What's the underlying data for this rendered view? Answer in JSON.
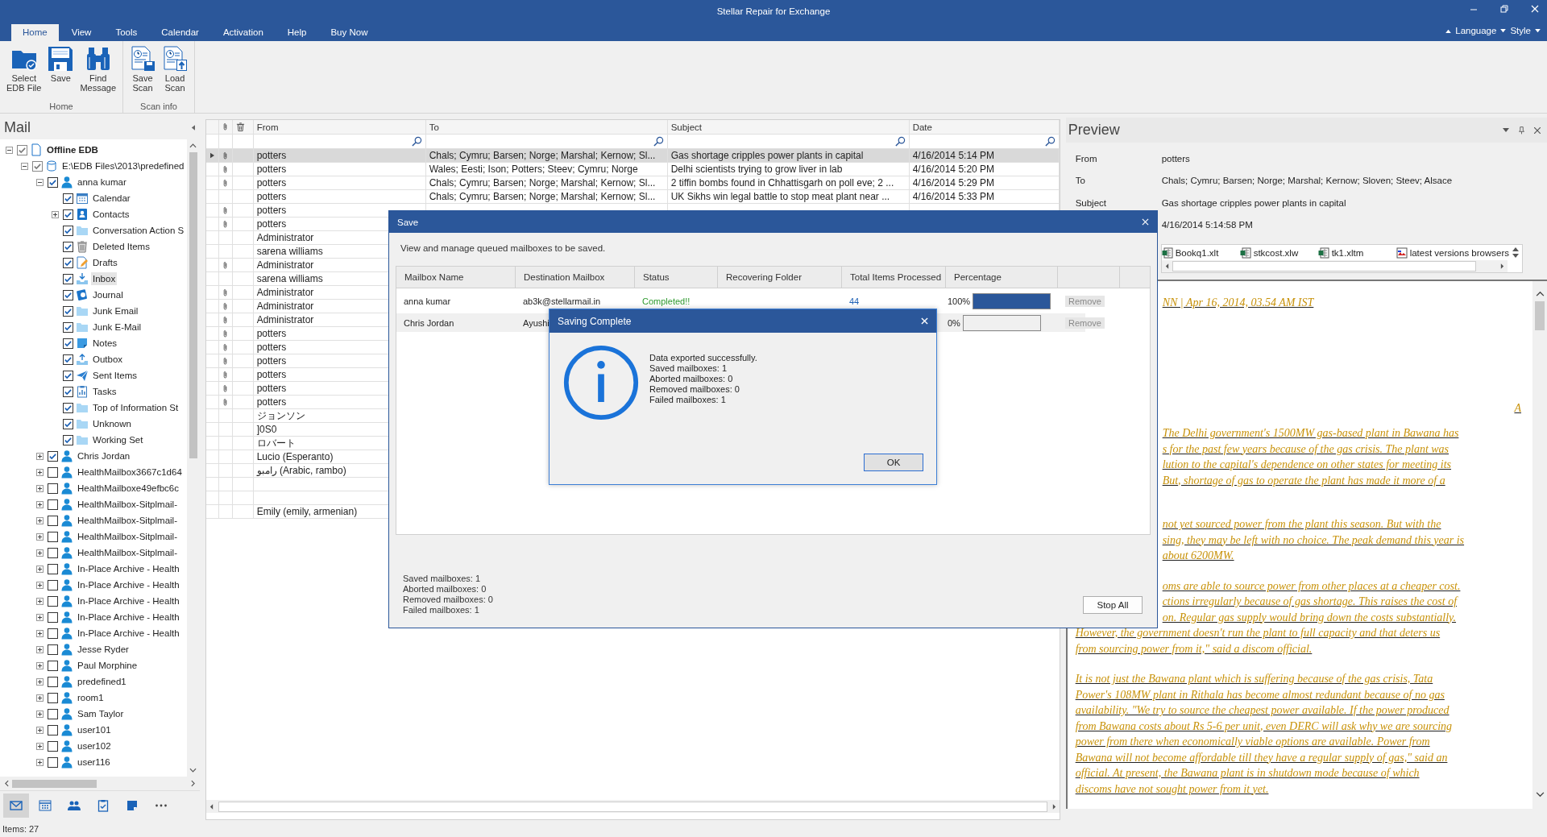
{
  "window": {
    "title": "Stellar Repair for Exchange"
  },
  "ribbon": {
    "tabs": [
      {
        "label": "Home",
        "selected": true
      },
      {
        "label": "View",
        "selected": false
      },
      {
        "label": "Tools",
        "selected": false
      },
      {
        "label": "Calendar",
        "selected": false
      },
      {
        "label": "Activation",
        "selected": false
      },
      {
        "label": "Help",
        "selected": false
      },
      {
        "label": "Buy Now",
        "selected": false
      }
    ],
    "right_menus": [
      "Language",
      "Style"
    ],
    "groups": [
      {
        "label": "Home",
        "buttons": [
          {
            "kind": "select_file",
            "label": "Select\nEDB File"
          },
          {
            "kind": "save",
            "label": "Save"
          },
          {
            "kind": "find",
            "label": "Find\nMessage"
          }
        ]
      },
      {
        "label": "Scan info",
        "buttons": [
          {
            "kind": "save_scan",
            "label": "Save\nScan"
          },
          {
            "kind": "load_scan",
            "label": "Load\nScan"
          }
        ]
      }
    ]
  },
  "mail_pane": {
    "title": "Mail",
    "tree": [
      {
        "label": "Offline EDB",
        "kind": "file",
        "checked": true,
        "partial": true,
        "expanded": true,
        "selected": false,
        "children": [
          {
            "label": "E:\\EDB Files\\2013\\predefined",
            "kind": "database",
            "checked": true,
            "partial": true,
            "expanded": true,
            "selected": false,
            "children": [
              {
                "label": "anna kumar",
                "kind": "mailbox",
                "checked": true,
                "expanded": true,
                "selected": false,
                "children": [
                  {
                    "label": "Calendar",
                    "kind": "calendar",
                    "checked": true,
                    "selected": false
                  },
                  {
                    "label": "Contacts",
                    "kind": "contacts",
                    "checked": true,
                    "expanded": false,
                    "selected": false
                  },
                  {
                    "label": "Conversation Action S",
                    "kind": "folder",
                    "checked": true,
                    "selected": false
                  },
                  {
                    "label": "Deleted Items",
                    "kind": "deleted",
                    "checked": true,
                    "selected": false
                  },
                  {
                    "label": "Drafts",
                    "kind": "drafts",
                    "checked": true,
                    "selected": false
                  },
                  {
                    "label": "Inbox",
                    "kind": "inbox",
                    "checked": true,
                    "selected": true
                  },
                  {
                    "label": "Journal",
                    "kind": "journal",
                    "checked": true,
                    "selected": false
                  },
                  {
                    "label": "Junk Email",
                    "kind": "folder",
                    "checked": true,
                    "selected": false
                  },
                  {
                    "label": "Junk E-Mail",
                    "kind": "folder",
                    "checked": true,
                    "selected": false
                  },
                  {
                    "label": "Notes",
                    "kind": "notes",
                    "checked": true,
                    "selected": false
                  },
                  {
                    "label": "Outbox",
                    "kind": "outbox",
                    "checked": true,
                    "selected": false
                  },
                  {
                    "label": "Sent Items",
                    "kind": "sent",
                    "checked": true,
                    "selected": false
                  },
                  {
                    "label": "Tasks",
                    "kind": "tasks",
                    "checked": true,
                    "selected": false
                  },
                  {
                    "label": "Top of Information St",
                    "kind": "folder",
                    "checked": true,
                    "selected": false
                  },
                  {
                    "label": "Unknown",
                    "kind": "folder",
                    "checked": true,
                    "selected": false
                  },
                  {
                    "label": "Working Set",
                    "kind": "folder",
                    "checked": true,
                    "selected": false
                  }
                ]
              },
              {
                "label": "Chris Jordan",
                "kind": "mailbox",
                "checked": true,
                "expanded": false,
                "selected": false
              },
              {
                "label": "HealthMailbox3667c1d64",
                "kind": "mailbox",
                "checked": false,
                "expanded": false,
                "selected": false
              },
              {
                "label": "HealthMailboxe49efbc6c",
                "kind": "mailbox",
                "checked": false,
                "expanded": false,
                "selected": false
              },
              {
                "label": "HealthMailbox-Sitplmail-",
                "kind": "mailbox",
                "checked": false,
                "expanded": false,
                "selected": false
              },
              {
                "label": "HealthMailbox-Sitplmail-",
                "kind": "mailbox",
                "checked": false,
                "expanded": false,
                "selected": false
              },
              {
                "label": "HealthMailbox-Sitplmail-",
                "kind": "mailbox",
                "checked": false,
                "expanded": false,
                "selected": false
              },
              {
                "label": "HealthMailbox-Sitplmail-",
                "kind": "mailbox",
                "checked": false,
                "expanded": false,
                "selected": false
              },
              {
                "label": "In-Place Archive - Health",
                "kind": "mailbox",
                "checked": false,
                "expanded": false,
                "selected": false
              },
              {
                "label": "In-Place Archive - Health",
                "kind": "mailbox",
                "checked": false,
                "expanded": false,
                "selected": false
              },
              {
                "label": "In-Place Archive - Health",
                "kind": "mailbox",
                "checked": false,
                "expanded": false,
                "selected": false
              },
              {
                "label": "In-Place Archive - Health",
                "kind": "mailbox",
                "checked": false,
                "expanded": false,
                "selected": false
              },
              {
                "label": "In-Place Archive - Health",
                "kind": "mailbox",
                "checked": false,
                "expanded": false,
                "selected": false
              },
              {
                "label": "Jesse Ryder",
                "kind": "mailbox",
                "checked": false,
                "expanded": false,
                "selected": false
              },
              {
                "label": "Paul Morphine",
                "kind": "mailbox",
                "checked": false,
                "expanded": false,
                "selected": false
              },
              {
                "label": "predefined1",
                "kind": "mailbox",
                "checked": false,
                "expanded": false,
                "selected": false
              },
              {
                "label": "room1",
                "kind": "mailbox",
                "checked": false,
                "expanded": false,
                "selected": false
              },
              {
                "label": "Sam Taylor",
                "kind": "mailbox",
                "checked": false,
                "expanded": false,
                "selected": false
              },
              {
                "label": "user101",
                "kind": "mailbox",
                "checked": false,
                "expanded": false,
                "selected": false
              },
              {
                "label": "user102",
                "kind": "mailbox",
                "checked": false,
                "expanded": false,
                "selected": false
              },
              {
                "label": "user116",
                "kind": "mailbox",
                "checked": false,
                "expanded": false,
                "selected": false
              }
            ]
          }
        ]
      }
    ],
    "nav": [
      {
        "kind": "mail",
        "selected": true
      },
      {
        "kind": "calendar",
        "selected": false
      },
      {
        "kind": "contacts",
        "selected": false
      },
      {
        "kind": "tasks",
        "selected": false
      },
      {
        "kind": "notes",
        "selected": false
      },
      {
        "kind": "more",
        "selected": false
      }
    ]
  },
  "message_list": {
    "columns": [
      "From",
      "To",
      "Subject",
      "Date"
    ],
    "rows": [
      {
        "selected": true,
        "attachment": true,
        "from": "potters",
        "to": "Chals; Cymru; Barsen; Norge; Marshal; Kernow; Sl...",
        "subject": "Gas shortage cripples power plants in capital",
        "date": "4/16/2014 5:14 PM"
      },
      {
        "selected": false,
        "attachment": true,
        "from": "potters",
        "to": "Wales; Eesti; Ison; Potters; Steev; Cymru; Norge",
        "subject": "Delhi scientists trying to grow liver in lab",
        "date": "4/16/2014 5:20 PM"
      },
      {
        "selected": false,
        "attachment": true,
        "from": "potters",
        "to": "Chals; Cymru; Barsen; Norge; Marshal; Kernow; Sl...",
        "subject": "2 tiffin bombs found in Chhattisgarh on poll eve; 2 ...",
        "date": "4/16/2014 5:29 PM"
      },
      {
        "selected": false,
        "attachment": false,
        "from": "potters",
        "to": "Chals; Cymru; Barsen; Norge; Marshal; Kernow; Sl...",
        "subject": "UK Sikhs win legal battle to stop meat plant near ...",
        "date": "4/16/2014 5:33 PM"
      },
      {
        "selected": false,
        "attachment": true,
        "from": "potters"
      },
      {
        "selected": false,
        "attachment": true,
        "from": "potters"
      },
      {
        "selected": false,
        "attachment": false,
        "from": "Administrator"
      },
      {
        "selected": false,
        "attachment": false,
        "from": "sarena williams"
      },
      {
        "selected": false,
        "attachment": true,
        "from": "Administrator"
      },
      {
        "selected": false,
        "attachment": false,
        "from": "sarena williams"
      },
      {
        "selected": false,
        "attachment": true,
        "from": "Administrator"
      },
      {
        "selected": false,
        "attachment": true,
        "from": "Administrator"
      },
      {
        "selected": false,
        "attachment": true,
        "from": "Administrator"
      },
      {
        "selected": false,
        "attachment": true,
        "from": "potters"
      },
      {
        "selected": false,
        "attachment": true,
        "from": "potters"
      },
      {
        "selected": false,
        "attachment": true,
        "from": "potters"
      },
      {
        "selected": false,
        "attachment": true,
        "from": "potters"
      },
      {
        "selected": false,
        "attachment": true,
        "from": "potters"
      },
      {
        "selected": false,
        "attachment": true,
        "from": "potters"
      },
      {
        "selected": false,
        "attachment": false,
        "from": "ジョンソン"
      },
      {
        "selected": false,
        "attachment": false,
        "from": "]0S0"
      },
      {
        "selected": false,
        "attachment": false,
        "from": "ロバート"
      },
      {
        "selected": false,
        "attachment": false,
        "from": "Lucio (Esperanto)"
      },
      {
        "selected": false,
        "attachment": false,
        "from": "رامبو (Arabic, rambo)"
      },
      {
        "selected": false,
        "attachment": false
      },
      {
        "selected": false,
        "attachment": false
      },
      {
        "selected": false,
        "attachment": false,
        "from": "Emily (emily, armenian)"
      }
    ]
  },
  "preview": {
    "title": "Preview",
    "fields": [
      {
        "label": "From",
        "value": "potters"
      },
      {
        "label": "To",
        "value": "Chals; Cymru; Barsen; Norge; Marshal; Kernow; Sloven; Steev; Alsace"
      },
      {
        "label": "Subject",
        "value": "Gas shortage cripples power plants in capital"
      },
      {
        "value": "4/16/2014 5:14:58 PM"
      }
    ],
    "attachments": [
      {
        "kind": "excel",
        "name": "Bookq1.xlt"
      },
      {
        "kind": "excel",
        "name": "stkcost.xlw"
      },
      {
        "kind": "excel",
        "name": "tk1.xltm"
      },
      {
        "kind": "image",
        "name": "latest versions browsers"
      }
    ],
    "body": [
      {
        "kind": "byline",
        "beside_dialog": [
          "NN | Apr 16, 2014, 03.54 AM IST"
        ]
      },
      {
        "kind": "marker",
        "lines": [
          "A"
        ]
      },
      {
        "kind": "paragraph",
        "beside_dialog": [
          "The Delhi government's 1500MW gas-based plant in Bawana has",
          "s for the past few years because of the gas crisis. The plant was",
          "lution to the capital's dependence on other states for meeting its",
          "But, shortage of gas to operate the plant has made it more of a"
        ]
      },
      {
        "kind": "paragraph",
        "beside_dialog": [
          "not yet sourced power from the plant this season. But with the",
          "sing, they may be left with no choice. The peak demand this year is",
          "about 6200MW."
        ]
      },
      {
        "kind": "paragraph",
        "beside_dialog": [
          "oms are able to source power from other places at a cheaper cost.",
          "ctions irregularly because of gas shortage. This raises the cost of",
          "on. Regular gas supply would bring down the costs substantially."
        ],
        "lines": [
          "However, the government doesn't run the plant to full capacity and that deters us",
          "from sourcing power from it,\" said a discom official."
        ]
      },
      {
        "kind": "paragraph",
        "lines": [
          "It is not just the Bawana plant which is suffering because of the gas crisis, Tata",
          "Power's 108MW plant in Rithala has become almost redundant because of no gas",
          "availability. \"We try to source the cheapest power available. If the power produced",
          "from Bawana costs about Rs 5-6 per unit, even DERC will ask why we are sourcing",
          "power from there when economically viable options are available. Power from",
          "Bawana will not become affordable till they have a regular supply of gas,\" said an",
          "official. At present, the Bawana plant is in shutdown mode because of which",
          "discoms have not sought power from it yet."
        ]
      }
    ]
  },
  "status_bar": {
    "text": "Items: 27"
  },
  "save_dialog": {
    "title": "Save",
    "description": "View and manage queued mailboxes to be saved.",
    "columns": [
      "Mailbox Name",
      "Destination Mailbox",
      "Status",
      "Recovering Folder",
      "Total Items Processed",
      "Percentage"
    ],
    "rows": [
      {
        "mailbox": "anna kumar",
        "destination": "ab3k@stellarmail.in",
        "status": "Completed!!",
        "items": "44",
        "percent": "100%",
        "level": 1,
        "remove": {
          "label": "Remove",
          "disabled": true
        }
      },
      {
        "mailbox": "Chris Jordan",
        "destination": "Ayushi",
        "percent": "0%",
        "level": 0,
        "remove": {
          "label": "Remove",
          "disabled": true
        }
      }
    ],
    "summary": [
      "Saved mailboxes: 1",
      "Aborted mailboxes: 0",
      "Removed mailboxes: 0",
      "Failed mailboxes: 1"
    ],
    "stop_button": "Stop All"
  },
  "complete_dialog": {
    "title": "Saving Complete",
    "message": [
      "Data exported successfully.",
      "Saved mailboxes: 1",
      "Aborted mailboxes: 0",
      "Removed mailboxes: 0",
      "Failed mailboxes: 1"
    ],
    "ok_button": "OK"
  }
}
